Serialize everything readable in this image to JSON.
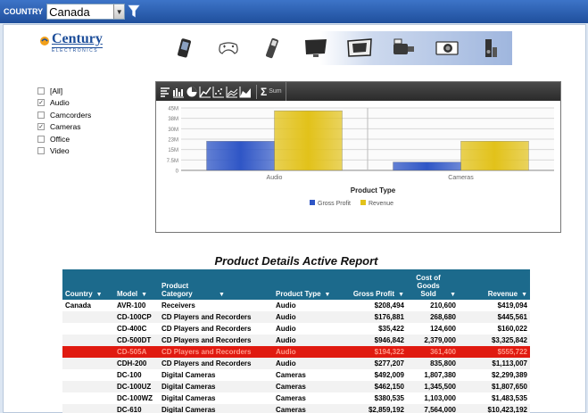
{
  "topbar": {
    "country_label": "COUNTRY",
    "country_value": "Canada",
    "filter_icon": "funnel-icon",
    "background": "#2a5eb0"
  },
  "logo": {
    "name": "Century",
    "sub": "ELECTRONICS"
  },
  "product_icons": [
    "phone-icon",
    "gamepad-icon",
    "mp3-player-icon",
    "monitor-icon",
    "tv-icon",
    "camcorder-icon",
    "camera-icon",
    "audio-speaker-icon"
  ],
  "filters": [
    {
      "label": "[All]",
      "checked": false
    },
    {
      "label": "Audio",
      "checked": true
    },
    {
      "label": "Camcorders",
      "checked": false
    },
    {
      "label": "Cameras",
      "checked": true
    },
    {
      "label": "Office",
      "checked": false
    },
    {
      "label": "Video",
      "checked": false
    }
  ],
  "chart_toolbar": {
    "icons": [
      "table-view-icon",
      "bar-chart-icon",
      "pie-chart-icon",
      "line-chart-icon",
      "scatter-chart-icon",
      "stacked-chart-icon",
      "area-chart-icon"
    ],
    "sum_label": "Sum"
  },
  "chart_data": {
    "type": "bar",
    "categories": [
      "Audio",
      "Cameras"
    ],
    "series": [
      {
        "name": "Gross Profit",
        "values": [
          21000000,
          6000000
        ],
        "color": "#2f56c6"
      },
      {
        "name": "Revenue",
        "values": [
          43000000,
          21000000
        ],
        "color": "#e2c21a"
      }
    ],
    "yticks": [
      "45M",
      "38M",
      "30M",
      "23M",
      "15M",
      "7.5M",
      "0"
    ],
    "ylim": [
      0,
      45000000
    ],
    "xlabel": "Product Type",
    "ylabel": "",
    "legend": "bottom-center",
    "grid": true
  },
  "report": {
    "title": "Product Details Active Report",
    "columns": [
      {
        "label": "Country",
        "align": "left"
      },
      {
        "label": "Model",
        "align": "left"
      },
      {
        "label": "Product Category",
        "align": "left"
      },
      {
        "label": "Product Type",
        "align": "left"
      },
      {
        "label": "Gross Profit",
        "align": "right"
      },
      {
        "label": "Cost of Goods Sold",
        "align": "right"
      },
      {
        "label": "Revenue",
        "align": "right"
      }
    ],
    "rows": [
      {
        "cells": [
          "Canada",
          "AVR-100",
          "Receivers",
          "Audio",
          "$208,494",
          "210,600",
          "$419,094"
        ],
        "highlight": false
      },
      {
        "cells": [
          "",
          "CD-100CP",
          "CD Players and Recorders",
          "Audio",
          "$176,881",
          "268,680",
          "$445,561"
        ],
        "highlight": false
      },
      {
        "cells": [
          "",
          "CD-400C",
          "CD Players and Recorders",
          "Audio",
          "$35,422",
          "124,600",
          "$160,022"
        ],
        "highlight": false
      },
      {
        "cells": [
          "",
          "CD-500DT",
          "CD Players and Recorders",
          "Audio",
          "$946,842",
          "2,379,000",
          "$3,325,842"
        ],
        "highlight": false
      },
      {
        "cells": [
          "",
          "CD-505A",
          "CD Players and Recorders",
          "Audio",
          "$194,322",
          "361,400",
          "$555,722"
        ],
        "highlight": true
      },
      {
        "cells": [
          "",
          "CDH-200",
          "CD Players and Recorders",
          "Audio",
          "$277,207",
          "835,800",
          "$1,113,007"
        ],
        "highlight": false
      },
      {
        "cells": [
          "",
          "DC-100",
          "Digital Cameras",
          "Cameras",
          "$492,009",
          "1,807,380",
          "$2,299,389"
        ],
        "highlight": false
      },
      {
        "cells": [
          "",
          "DC-100UZ",
          "Digital Cameras",
          "Cameras",
          "$462,150",
          "1,345,500",
          "$1,807,650"
        ],
        "highlight": false
      },
      {
        "cells": [
          "",
          "DC-100WZ",
          "Digital Cameras",
          "Cameras",
          "$380,535",
          "1,103,000",
          "$1,483,535"
        ],
        "highlight": false
      },
      {
        "cells": [
          "",
          "DC-610",
          "Digital Cameras",
          "Cameras",
          "$2,859,192",
          "7,564,000",
          "$10,423,192"
        ],
        "highlight": false
      }
    ],
    "highlight_color": "#e01a10"
  }
}
